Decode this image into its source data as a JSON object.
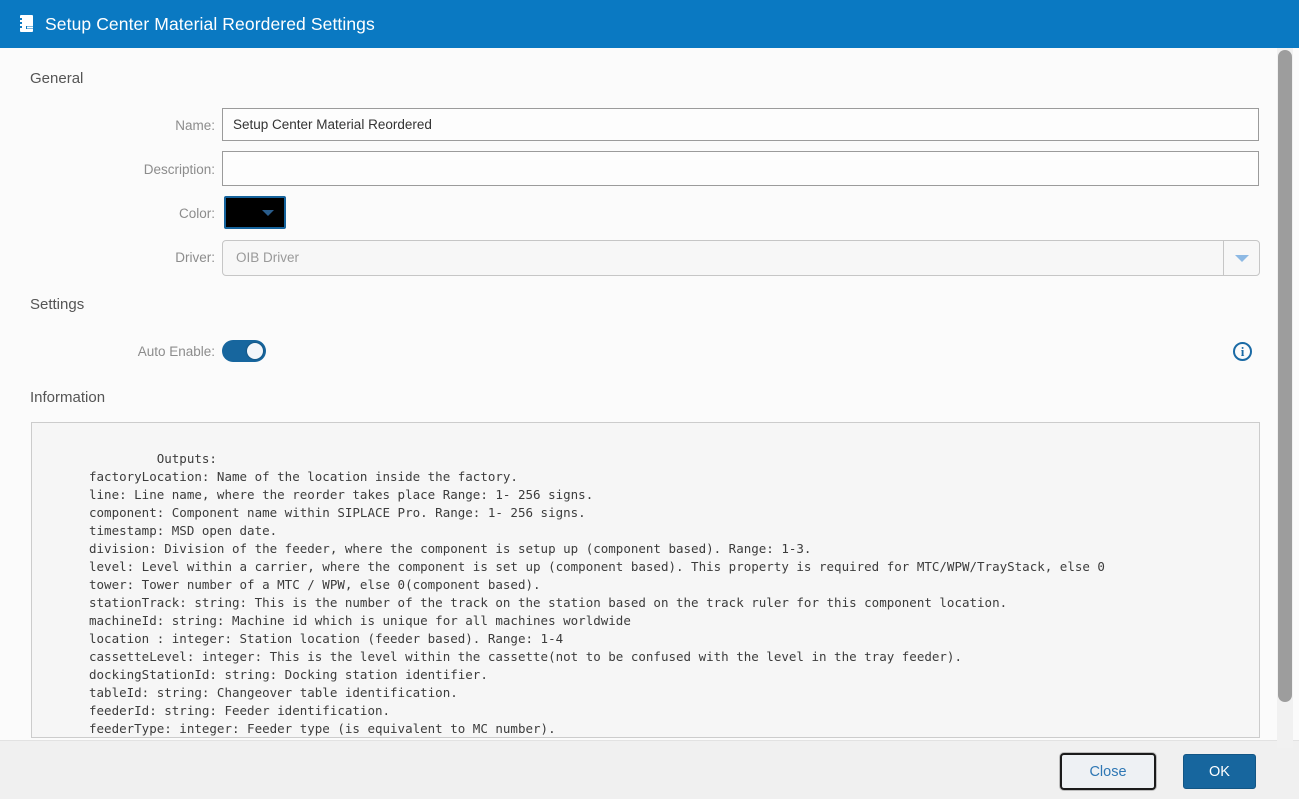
{
  "window": {
    "title": "Setup Center Material Reordered Settings"
  },
  "general": {
    "heading": "General",
    "name_label": "Name:",
    "name_value": "Setup Center Material Reordered",
    "description_label": "Description:",
    "description_value": "",
    "color_label": "Color:",
    "color_value": "#000000",
    "driver_label": "Driver:",
    "driver_value": "OIB Driver"
  },
  "settings": {
    "heading": "Settings",
    "auto_enable_label": "Auto Enable:",
    "auto_enable_state": "on"
  },
  "information": {
    "heading": "Information",
    "text": "         Outputs:\nfactoryLocation: Name of the location inside the factory.\nline: Line name, where the reorder takes place Range: 1- 256 signs.\ncomponent: Component name within SIPLACE Pro. Range: 1- 256 signs.\ntimestamp: MSD open date.\ndivision: Division of the feeder, where the component is setup up (component based). Range: 1-3.\nlevel: Level within a carrier, where the component is set up (component based). This property is required for MTC/WPW/TrayStack, else 0\ntower: Tower number of a MTC / WPW, else 0(component based).\nstationTrack: string: This is the number of the track on the station based on the track ruler for this component location.\nmachineId: string: Machine id which is unique for all machines worldwide\nlocation : integer: Station location (feeder based). Range: 1-4\ncassetteLevel: integer: This is the level within the cassette(not to be confused with the level in the tray feeder).\ndockingStationId: string: Docking station identifier.\ntableId: string: Changeover table identification.\nfeederId: string: Feeder identification.\nfeederType: integer: Feeder type (is equivalent to MC number)."
  },
  "footer": {
    "close_label": "Close",
    "ok_label": "OK"
  },
  "info_tooltip": {
    "symbol": "i"
  },
  "colors": {
    "titlebar_bg": "#0a79c2",
    "accent_blue": "#17669e",
    "toggle_on": "#17669e",
    "color_swatch": "#000000",
    "close_text": "#2e77b4"
  }
}
